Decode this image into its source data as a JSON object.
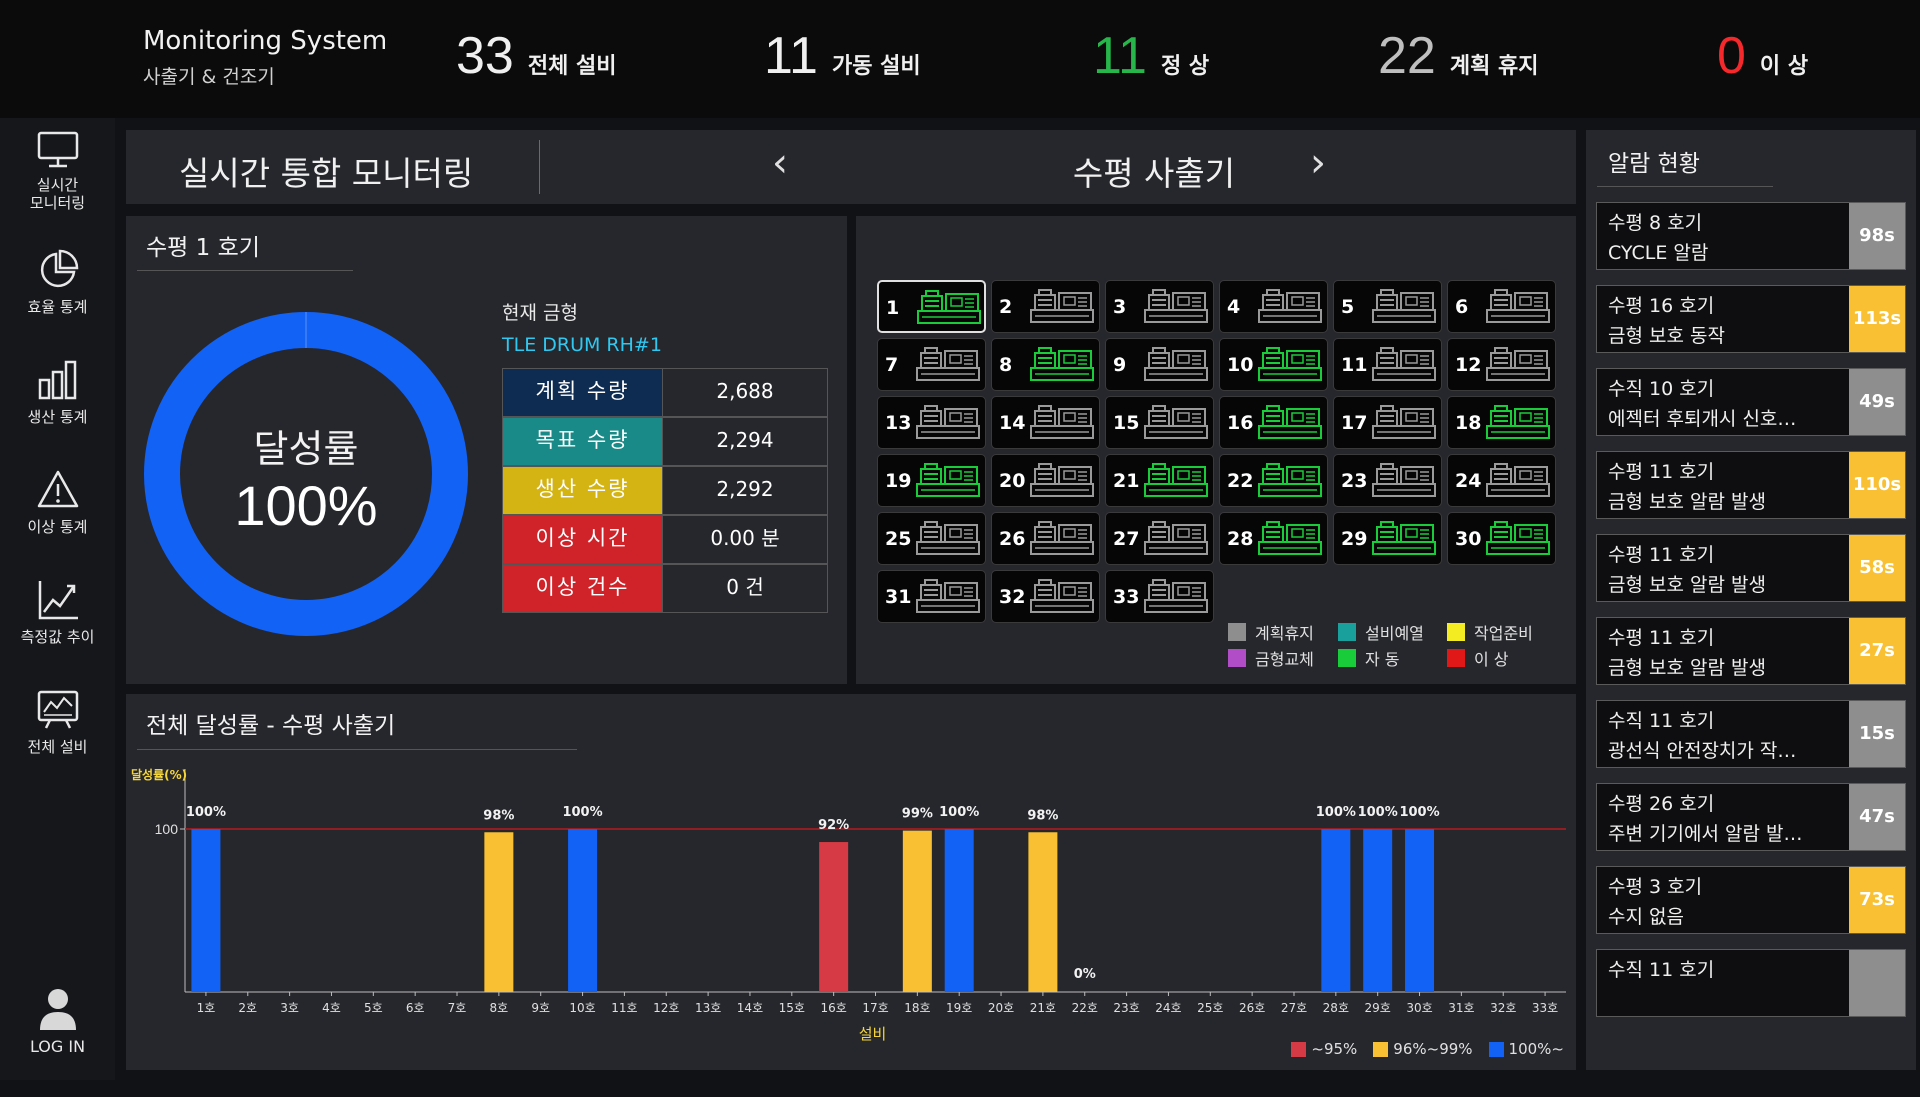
{
  "colors": {
    "blue": "#1262f5",
    "yellow": "#f8c032",
    "red": "#d63a44",
    "gray": "#8e8e8e",
    "green": "#19cc3a",
    "teal": "#1aa09c",
    "purple": "#b14ec7"
  },
  "header": {
    "title": "Monitoring System",
    "subtitle": "사출기 & 건조기",
    "kpis": [
      {
        "value": "33",
        "label": "전체 설비",
        "color": "#f0f0f0"
      },
      {
        "value": "11",
        "label": "가동 설비",
        "color": "#f0f0f0"
      },
      {
        "value": "11",
        "label": "정 상",
        "color": "#27b64a"
      },
      {
        "value": "22",
        "label": "계획 휴지",
        "color": "#bfbfbf"
      },
      {
        "value": "0",
        "label": "이 상",
        "color": "#f5282c"
      }
    ]
  },
  "sidebar": {
    "items": [
      {
        "label": "실시간\n모니터링",
        "icon": "monitor-icon"
      },
      {
        "label": "효율 통계",
        "icon": "pie-chart-icon"
      },
      {
        "label": "생산 통계",
        "icon": "bar-chart-icon"
      },
      {
        "label": "이상 통계",
        "icon": "warning-icon"
      },
      {
        "label": "측정값 추이",
        "icon": "line-chart-icon"
      },
      {
        "label": "전체 설비",
        "icon": "equipment-icon"
      }
    ],
    "login": "LOG IN"
  },
  "titlebar": {
    "title": "실시간 통합 모니터링",
    "machine_type": "수평 사출기",
    "prev": "‹",
    "next": "›"
  },
  "unit": {
    "title": "수평 1 호기",
    "donut_label": "달성률",
    "donut_value": "100%",
    "achievement": 100,
    "current_mold_label": "현재 금형",
    "current_mold": "TLE DRUM RH#1",
    "stats": [
      {
        "label": "계획 수량",
        "value": "2,688",
        "color": "#0e2b52"
      },
      {
        "label": "목표 수량",
        "value": "2,294",
        "color": "#1a8a88"
      },
      {
        "label": "생산 수량",
        "value": "2,292",
        "color": "#d4b412"
      },
      {
        "label": "이상 시간",
        "value": "0.00 분",
        "color": "#cf2229"
      },
      {
        "label": "이상 건수",
        "value": "0 건",
        "color": "#cf2229"
      }
    ]
  },
  "machines": [
    {
      "no": "1",
      "status": "green"
    },
    {
      "no": "2",
      "status": "gray"
    },
    {
      "no": "3",
      "status": "gray"
    },
    {
      "no": "4",
      "status": "gray"
    },
    {
      "no": "5",
      "status": "gray"
    },
    {
      "no": "6",
      "status": "gray"
    },
    {
      "no": "7",
      "status": "gray"
    },
    {
      "no": "8",
      "status": "green"
    },
    {
      "no": "9",
      "status": "gray"
    },
    {
      "no": "10",
      "status": "green"
    },
    {
      "no": "11",
      "status": "gray"
    },
    {
      "no": "12",
      "status": "gray"
    },
    {
      "no": "13",
      "status": "gray"
    },
    {
      "no": "14",
      "status": "gray"
    },
    {
      "no": "15",
      "status": "gray"
    },
    {
      "no": "16",
      "status": "green"
    },
    {
      "no": "17",
      "status": "gray"
    },
    {
      "no": "18",
      "status": "green"
    },
    {
      "no": "19",
      "status": "green"
    },
    {
      "no": "20",
      "status": "gray"
    },
    {
      "no": "21",
      "status": "green"
    },
    {
      "no": "22",
      "status": "green"
    },
    {
      "no": "23",
      "status": "gray"
    },
    {
      "no": "24",
      "status": "gray"
    },
    {
      "no": "25",
      "status": "gray"
    },
    {
      "no": "26",
      "status": "gray"
    },
    {
      "no": "27",
      "status": "gray"
    },
    {
      "no": "28",
      "status": "green"
    },
    {
      "no": "29",
      "status": "green"
    },
    {
      "no": "30",
      "status": "green"
    },
    {
      "no": "31",
      "status": "gray"
    },
    {
      "no": "32",
      "status": "gray"
    },
    {
      "no": "33",
      "status": "gray"
    }
  ],
  "status_legend": [
    {
      "label": "계획휴지",
      "color": "#8e8e8e"
    },
    {
      "label": "설비예열",
      "color": "#1aa09c"
    },
    {
      "label": "작업준비",
      "color": "#f3ec22"
    },
    {
      "label": "금형교체",
      "color": "#b14ec7"
    },
    {
      "label": "자 동",
      "color": "#19cc3a"
    },
    {
      "label": "이 상",
      "color": "#e01818"
    }
  ],
  "chart_data": {
    "type": "bar",
    "title": "전체 달성률 - 수평 사출기",
    "ylabel": "달성률(%)",
    "xlabel": "설비",
    "ylim": [
      0,
      100
    ],
    "yticks": [
      100
    ],
    "target_line": 100,
    "categories": [
      "1호",
      "2호",
      "3호",
      "4호",
      "5호",
      "6호",
      "7호",
      "8호",
      "9호",
      "10호",
      "11호",
      "12호",
      "13호",
      "14호",
      "15호",
      "16호",
      "17호",
      "18호",
      "19호",
      "20호",
      "21호",
      "22호",
      "23호",
      "24호",
      "25호",
      "26호",
      "27호",
      "28호",
      "29호",
      "30호",
      "31호",
      "32호",
      "33호"
    ],
    "values": [
      100,
      null,
      null,
      null,
      null,
      null,
      null,
      98,
      null,
      100,
      null,
      null,
      null,
      null,
      null,
      92,
      null,
      99,
      100,
      null,
      98,
      0,
      null,
      null,
      null,
      null,
      null,
      100,
      100,
      100,
      null,
      null,
      null
    ],
    "legend": [
      {
        "label": "~95%",
        "color": "#d63a44"
      },
      {
        "label": "96%~99%",
        "color": "#f8c032"
      },
      {
        "label": "100%~",
        "color": "#1262f5"
      }
    ]
  },
  "alarms": {
    "title": "알람 현황",
    "items": [
      {
        "line1": "수평 8 호기",
        "line2": "CYCLE 알람",
        "secs": "98s",
        "color": "#8e8e8e"
      },
      {
        "line1": "수평 16 호기",
        "line2": "금형 보호 동작",
        "secs": "113s",
        "color": "#f8c032"
      },
      {
        "line1": "수직 10 호기",
        "line2": "에젝터 후퇴개시 신호…",
        "secs": "49s",
        "color": "#8e8e8e"
      },
      {
        "line1": "수평 11 호기",
        "line2": "금형 보호 알람 발생",
        "secs": "110s",
        "color": "#f8c032"
      },
      {
        "line1": "수평 11 호기",
        "line2": "금형 보호 알람 발생",
        "secs": "58s",
        "color": "#f8c032"
      },
      {
        "line1": "수평 11 호기",
        "line2": "금형 보호 알람 발생",
        "secs": "27s",
        "color": "#f8c032"
      },
      {
        "line1": "수직 11 호기",
        "line2": "광선식 안전장치가 작…",
        "secs": "15s",
        "color": "#8e8e8e"
      },
      {
        "line1": "수평 26 호기",
        "line2": "주변 기기에서 알람 발…",
        "secs": "47s",
        "color": "#8e8e8e"
      },
      {
        "line1": "수평 3 호기",
        "line2": "수지 없음",
        "secs": "73s",
        "color": "#f8c032"
      },
      {
        "line1": "수직 11 호기",
        "line2": "",
        "secs": "",
        "color": "#8e8e8e"
      }
    ]
  }
}
